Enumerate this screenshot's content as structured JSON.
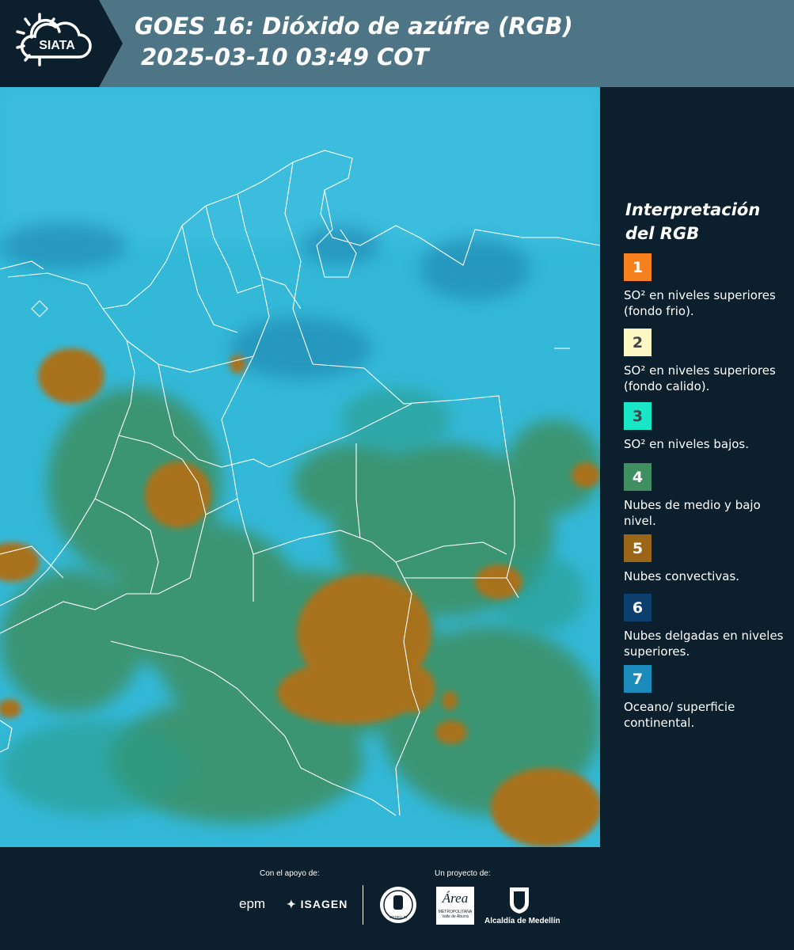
{
  "header": {
    "logo_text": "SIATA",
    "title_line1": "GOES 16: Dióxido de azúfre (RGB)",
    "title_line2": "2025-03-10 03:49 COT"
  },
  "legend": {
    "title_line1": "Interpretación",
    "title_line2": "del RGB",
    "items": [
      {
        "number": "1",
        "color": "#f7811e",
        "label": "SO² en niveles superiores (fondo frio)."
      },
      {
        "number": "2",
        "color": "#fff8c4",
        "label": "SO² en niveles superiores (fondo calido)."
      },
      {
        "number": "3",
        "color": "#19e6c6",
        "label": "SO² en niveles bajos."
      },
      {
        "number": "4",
        "color": "#3f8f60",
        "label": "Nubes de medio y bajo nivel."
      },
      {
        "number": "5",
        "color": "#9b6618",
        "label": "Nubes convectivas."
      },
      {
        "number": "6",
        "color": "#0c3e6e",
        "label": "Nubes delgadas en niveles superiores."
      },
      {
        "number": "7",
        "color": "#1a8bbb",
        "label": "Oceano/ superficie continental."
      }
    ]
  },
  "footer": {
    "support_label": "Con el apoyo de:",
    "project_label": "Un proyecto de:",
    "sponsor1": "epm",
    "sponsor2": "ISAGEN",
    "partner_area_main": "Área",
    "partner_area_sub1": "METROPOLITANA",
    "partner_area_sub2": "Valle de Aburrá",
    "partner_alcaldia": "Alcaldía de Medellín",
    "seal_text": "MEDELLÍN"
  },
  "colors": {
    "header_bg": "#4d7585",
    "panel_bg": "#0c1f2c",
    "ocean": "#33b8d8",
    "vegetation": "#3d8f62",
    "convective": "#a8721f",
    "border_lines": "#ffffff"
  }
}
